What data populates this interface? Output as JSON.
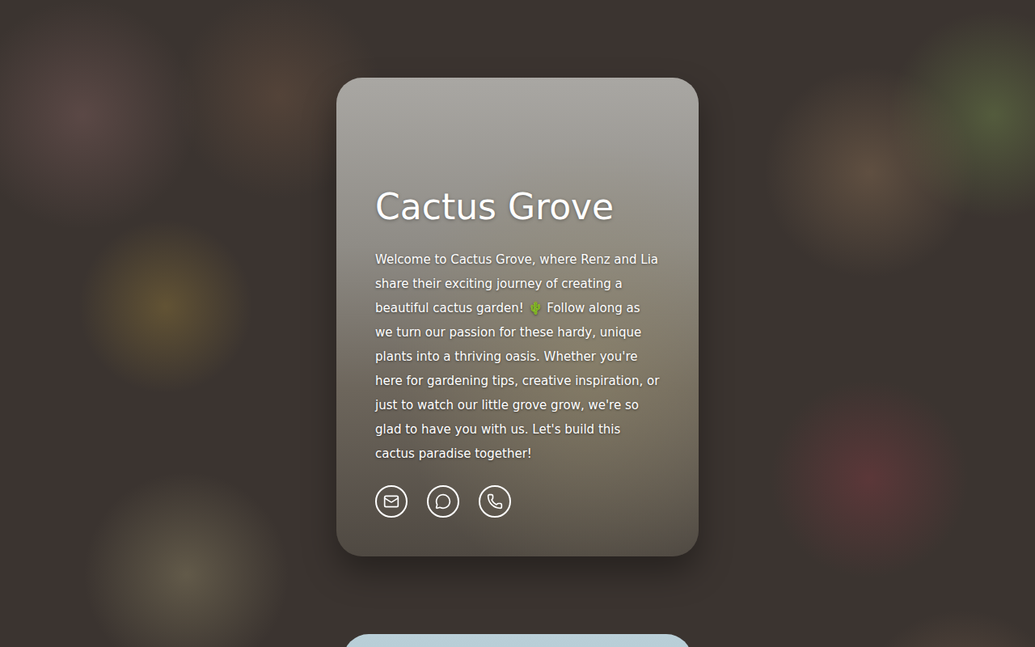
{
  "profile": {
    "title": "Cactus Grove",
    "bio": "Welcome to Cactus Grove, where Renz and Lia share their exciting journey of creating a beautiful cactus garden! 🌵 Follow along as we turn our passion for these hardy, unique plants into a thriving oasis. Whether you're here for gardening tips, creative inspiration, or just to watch our little grove grow, we're so glad to have you with us. Let's build this cactus paradise together!"
  },
  "contacts": [
    {
      "kind": "email"
    },
    {
      "kind": "message"
    },
    {
      "kind": "phone"
    }
  ]
}
